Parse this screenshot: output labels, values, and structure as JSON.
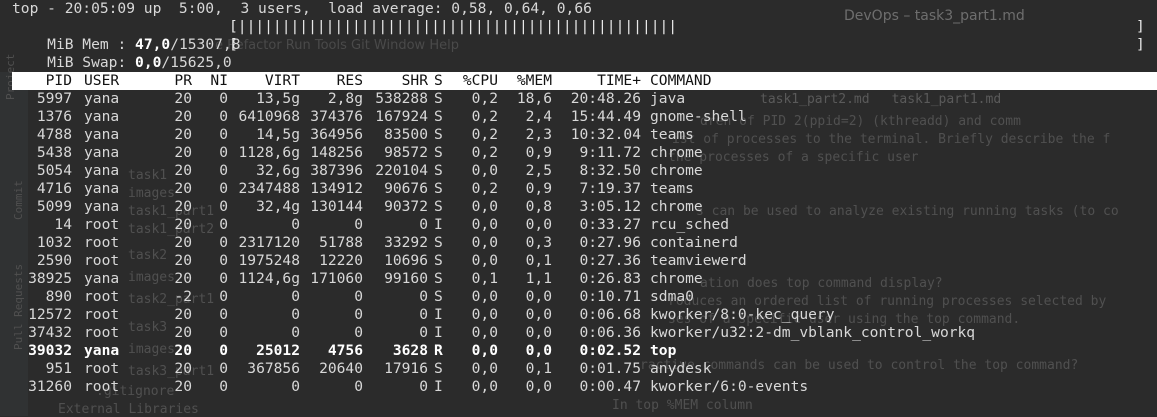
{
  "background": {
    "window_title": "DevOps – task3_part1.md",
    "menu": "e  Refactor  Run  Tools  Git  Window  Help",
    "tabs": [
      "task1_part2.md",
      "task1_part1.md"
    ],
    "lines": [
      "dren of PID 2(ppid=2) (kthreadd) and comm",
      "ist of processes to the terminal. Briefly describe the f",
      "the processes of a specific user",
      "s can be used to analyze existing running tasks (to co",
      "ation does top command display?",
      "roduces an ordered list of running processes selected by",
      "ses of a specific user using the top command.",
      "ractive commands can be used to control the top command?",
      "In top %MEM column"
    ],
    "sidebar_labels": [
      "Project",
      "Commit",
      "Pull Requests"
    ],
    "tree_items": [
      "task1",
      "images",
      "task1_part1",
      "task1_part2",
      "task2",
      "images",
      "task2_part1",
      "task3",
      "images",
      "task3_part1",
      ".gitignore",
      "External Libraries"
    ]
  },
  "top": {
    "line1": "top - 20:05:09 up  5:00,  3 users,  load average: 0,58, 0,64, 0,66",
    "mem_label": "MiB Mem : ",
    "mem_used": "47,0",
    "mem_total": "/15307,8",
    "mem_bar": "[||||||||||||||||||||||||||||||||||||||||||||||||||",
    "mem_bar_end": "]",
    "swap_label": "MiB Swap: ",
    "swap_used": "0,0",
    "swap_total": "/15625,0",
    "swap_bar": "[",
    "swap_bar_end": "]"
  },
  "columns": [
    "PID",
    "USER",
    "PR",
    "NI",
    "VIRT",
    "RES",
    "SHR",
    "S",
    "%CPU",
    "%MEM",
    "TIME+",
    "COMMAND"
  ],
  "processes": [
    {
      "pid": "5997",
      "user": "yana",
      "pr": "20",
      "ni": "0",
      "virt": "13,5g",
      "res": "2,8g",
      "shr": "538288",
      "s": "S",
      "cpu": "0,2",
      "mem": "18,6",
      "time": "20:48.26",
      "cmd": "java"
    },
    {
      "pid": "1376",
      "user": "yana",
      "pr": "20",
      "ni": "0",
      "virt": "6410968",
      "res": "374376",
      "shr": "167924",
      "s": "S",
      "cpu": "0,2",
      "mem": "2,4",
      "time": "15:44.49",
      "cmd": "gnome-shell"
    },
    {
      "pid": "4788",
      "user": "yana",
      "pr": "20",
      "ni": "0",
      "virt": "14,5g",
      "res": "364956",
      "shr": "83500",
      "s": "S",
      "cpu": "0,2",
      "mem": "2,3",
      "time": "10:32.04",
      "cmd": "teams"
    },
    {
      "pid": "5438",
      "user": "yana",
      "pr": "20",
      "ni": "0",
      "virt": "1128,6g",
      "res": "148256",
      "shr": "98572",
      "s": "S",
      "cpu": "0,2",
      "mem": "0,9",
      "time": "9:11.72",
      "cmd": "chrome"
    },
    {
      "pid": "5054",
      "user": "yana",
      "pr": "20",
      "ni": "0",
      "virt": "32,6g",
      "res": "387396",
      "shr": "220104",
      "s": "S",
      "cpu": "0,0",
      "mem": "2,5",
      "time": "8:32.50",
      "cmd": "chrome"
    },
    {
      "pid": "4716",
      "user": "yana",
      "pr": "20",
      "ni": "0",
      "virt": "2347488",
      "res": "134912",
      "shr": "90676",
      "s": "S",
      "cpu": "0,2",
      "mem": "0,9",
      "time": "7:19.37",
      "cmd": "teams"
    },
    {
      "pid": "5099",
      "user": "yana",
      "pr": "20",
      "ni": "0",
      "virt": "32,4g",
      "res": "130144",
      "shr": "90372",
      "s": "S",
      "cpu": "0,0",
      "mem": "0,8",
      "time": "3:05.12",
      "cmd": "chrome"
    },
    {
      "pid": "14",
      "user": "root",
      "pr": "20",
      "ni": "0",
      "virt": "0",
      "res": "0",
      "shr": "0",
      "s": "I",
      "cpu": "0,0",
      "mem": "0,0",
      "time": "0:33.27",
      "cmd": "rcu_sched"
    },
    {
      "pid": "1032",
      "user": "root",
      "pr": "20",
      "ni": "0",
      "virt": "2317120",
      "res": "51788",
      "shr": "33292",
      "s": "S",
      "cpu": "0,0",
      "mem": "0,3",
      "time": "0:27.96",
      "cmd": "containerd"
    },
    {
      "pid": "2590",
      "user": "root",
      "pr": "20",
      "ni": "0",
      "virt": "1975248",
      "res": "12220",
      "shr": "10696",
      "s": "S",
      "cpu": "0,0",
      "mem": "0,1",
      "time": "0:27.36",
      "cmd": "teamviewerd"
    },
    {
      "pid": "38925",
      "user": "yana",
      "pr": "20",
      "ni": "0",
      "virt": "1124,6g",
      "res": "171060",
      "shr": "99160",
      "s": "S",
      "cpu": "0,1",
      "mem": "1,1",
      "time": "0:26.83",
      "cmd": "chrome"
    },
    {
      "pid": "890",
      "user": "root",
      "pr": "-2",
      "ni": "0",
      "virt": "0",
      "res": "0",
      "shr": "0",
      "s": "S",
      "cpu": "0,0",
      "mem": "0,0",
      "time": "0:10.71",
      "cmd": "sdma0"
    },
    {
      "pid": "12572",
      "user": "root",
      "pr": "20",
      "ni": "0",
      "virt": "0",
      "res": "0",
      "shr": "0",
      "s": "I",
      "cpu": "0,0",
      "mem": "0,0",
      "time": "0:06.68",
      "cmd": "kworker/8:0-kec_query"
    },
    {
      "pid": "37432",
      "user": "root",
      "pr": "20",
      "ni": "0",
      "virt": "0",
      "res": "0",
      "shr": "0",
      "s": "I",
      "cpu": "0,0",
      "mem": "0,0",
      "time": "0:06.36",
      "cmd": "kworker/u32:2-dm_vblank_control_workq"
    },
    {
      "pid": "39032",
      "user": "yana",
      "pr": "20",
      "ni": "0",
      "virt": "25012",
      "res": "4756",
      "shr": "3628",
      "s": "R",
      "cpu": "0,0",
      "mem": "0,0",
      "time": "0:02.52",
      "cmd": "top",
      "bold": true
    },
    {
      "pid": "951",
      "user": "root",
      "pr": "20",
      "ni": "0",
      "virt": "367856",
      "res": "20640",
      "shr": "17916",
      "s": "S",
      "cpu": "0,0",
      "mem": "0,1",
      "time": "0:01.75",
      "cmd": "anydesk"
    },
    {
      "pid": "31260",
      "user": "root",
      "pr": "20",
      "ni": "0",
      "virt": "0",
      "res": "0",
      "shr": "0",
      "s": "I",
      "cpu": "0,0",
      "mem": "0,0",
      "time": "0:00.47",
      "cmd": "kworker/6:0-events"
    }
  ]
}
